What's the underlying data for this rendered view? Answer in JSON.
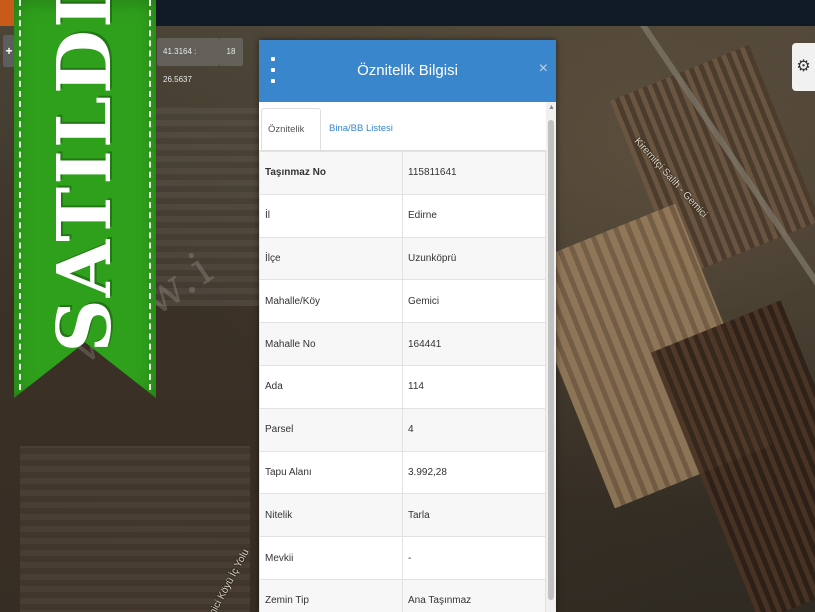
{
  "banner": {
    "text": "SATILDI",
    "color": "#2fa01c"
  },
  "watermark": {
    "text": "www.i"
  },
  "map": {
    "coordinates": "41.3164 : 26.5637",
    "zoom": "18",
    "zoom_in_symbol": "+",
    "label_road_1": "Kiremitçi Salih - Gemici",
    "label_road_2": "Gemici Köyü İç Yolu",
    "icons": {
      "settings": "gear-icon",
      "zoom": "plus-icon"
    }
  },
  "dialog": {
    "title": "Öznitelik Bilgisi",
    "close_symbol": "×",
    "header_color": "#3a86cd",
    "tabs": [
      {
        "label": "Öznitelik Bilgisi",
        "active": true
      },
      {
        "label": "Bina/BB Listesi",
        "active": false
      }
    ],
    "rows": [
      {
        "key": "Taşınmaz No",
        "value": "115811641"
      },
      {
        "key": "İl",
        "value": "Edirne"
      },
      {
        "key": "İlçe",
        "value": "Uzunköprü"
      },
      {
        "key": "Mahalle/Köy",
        "value": "Gemici"
      },
      {
        "key": "Mahalle No",
        "value": "164441"
      },
      {
        "key": "Ada",
        "value": "114"
      },
      {
        "key": "Parsel",
        "value": "4"
      },
      {
        "key": "Tapu Alanı",
        "value": "3.992,28"
      },
      {
        "key": "Nitelik",
        "value": "Tarla"
      },
      {
        "key": "Mevkii",
        "value": "-"
      },
      {
        "key": "Zemin Tip",
        "value": "Ana Taşınmaz"
      }
    ]
  }
}
